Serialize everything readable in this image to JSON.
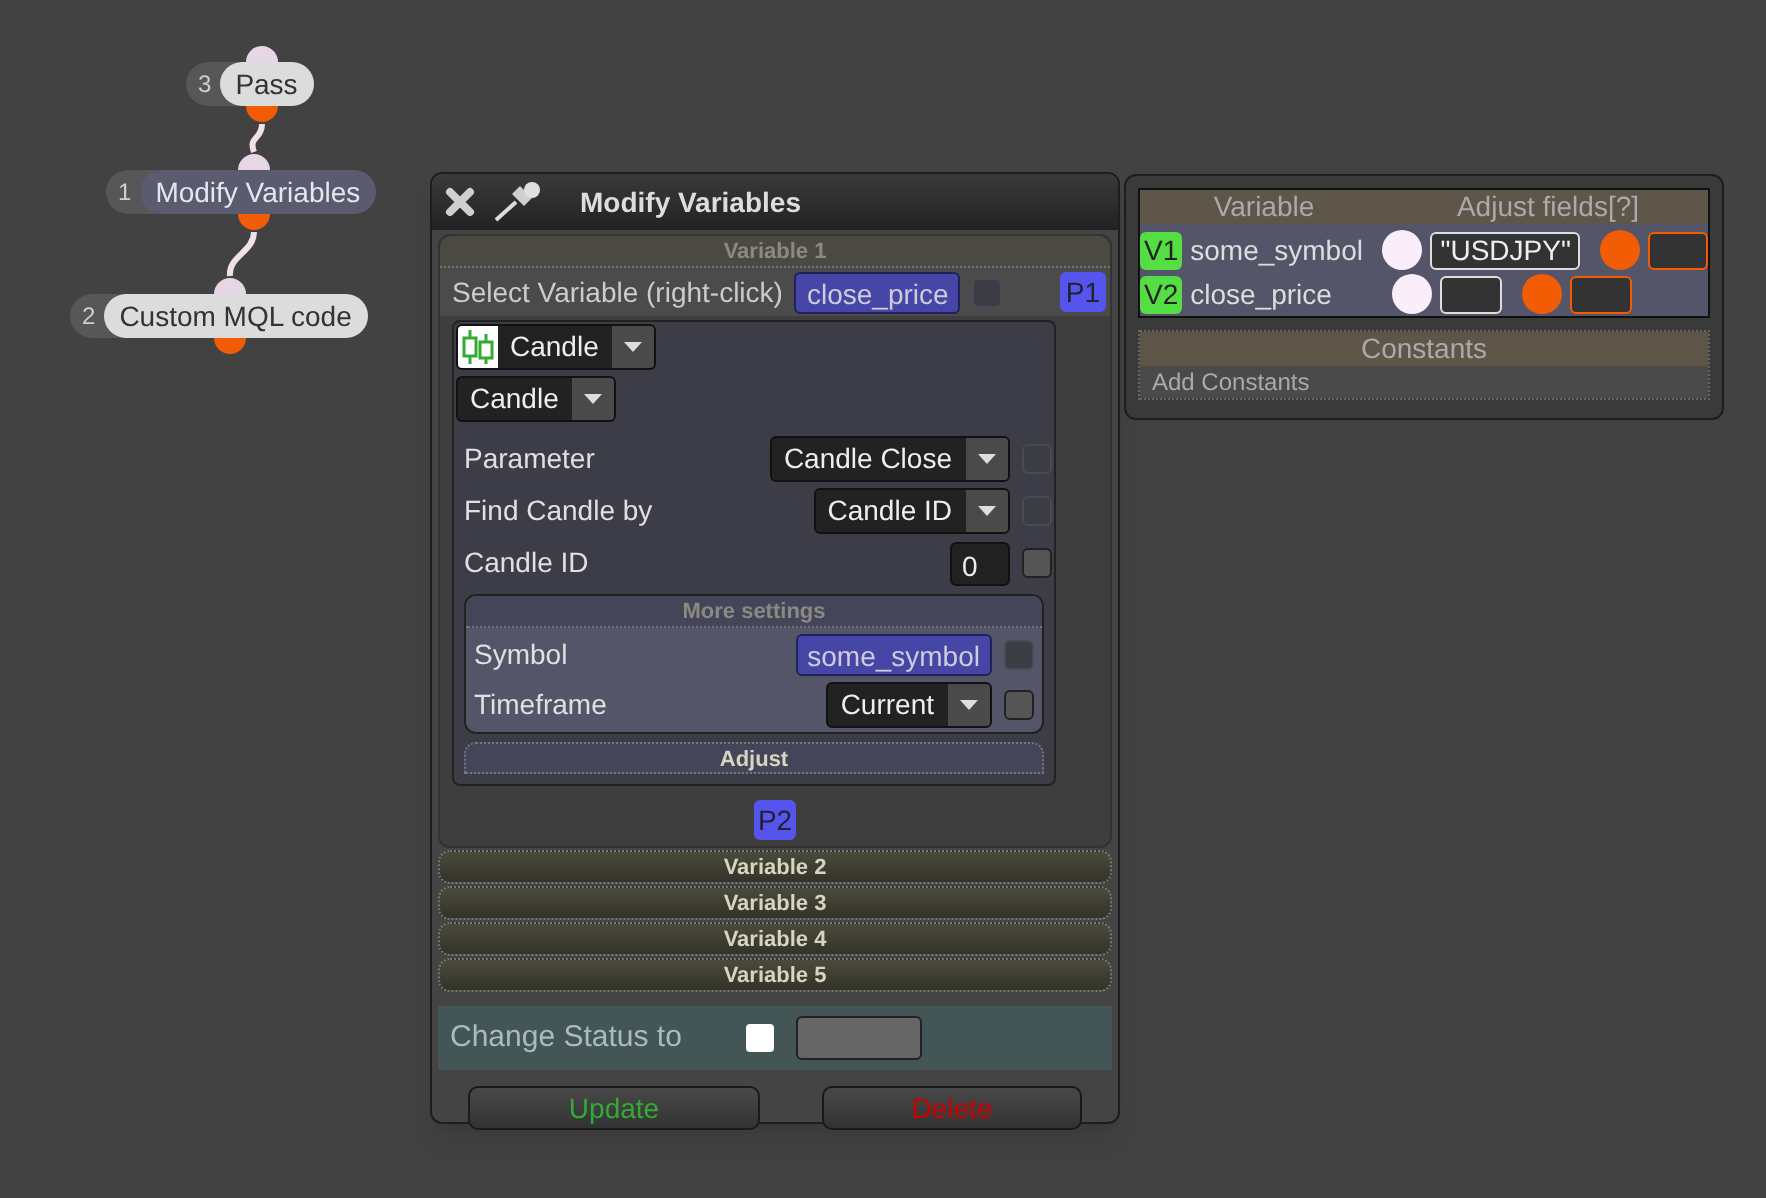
{
  "nodes": [
    {
      "number": "3",
      "label": "Pass",
      "selected": false
    },
    {
      "number": "1",
      "label": "Modify Variables",
      "selected": true
    },
    {
      "number": "2",
      "label": "Custom MQL code",
      "selected": false
    }
  ],
  "window": {
    "title": "Modify Variables",
    "variable_1": {
      "label": "Variable 1",
      "expanded": true
    },
    "select_variable": {
      "label": "Select Variable (right-click)",
      "value": "close_price",
      "checkbox": {
        "checked": false,
        "disabled": true
      },
      "badge": "P1"
    },
    "type_dropdown": "Candle",
    "sub_dropdown": "Candle",
    "rows": [
      {
        "kind": "dropdown",
        "label": "Parameter",
        "value": "Candle Close",
        "checkbox": {
          "checked": false,
          "disabled": true
        }
      },
      {
        "kind": "dropdown",
        "label": "Find Candle by",
        "value": "Candle ID",
        "checkbox": {
          "checked": false,
          "disabled": true
        }
      },
      {
        "kind": "number",
        "label": "Candle ID",
        "value": "0",
        "checkbox": {
          "checked": false,
          "disabled": false
        }
      }
    ],
    "more_settings": {
      "label": "More settings",
      "expanded": true,
      "rows": [
        {
          "kind": "variable",
          "label": "Symbol",
          "value": "some_symbol",
          "checkbox": {
            "checked": false,
            "disabled": true
          }
        },
        {
          "kind": "dropdown",
          "label": "Timeframe",
          "value": "Current",
          "checkbox": {
            "checked": false,
            "disabled": false
          }
        }
      ]
    },
    "adjust": {
      "label": "Adjust",
      "expanded": false
    },
    "badge_2": "P2",
    "other_variables": [
      {
        "label": "Variable 2",
        "expanded": false
      },
      {
        "label": "Variable 3",
        "expanded": false
      },
      {
        "label": "Variable 4",
        "expanded": false
      },
      {
        "label": "Variable 5",
        "expanded": false
      }
    ],
    "change_status": {
      "label": "Change Status to",
      "checked": false
    },
    "buttons": [
      {
        "label": "Update",
        "kind": "update"
      },
      {
        "label": "Delete",
        "kind": "delete"
      }
    ]
  },
  "variables_panel": {
    "columns": [
      "Variable",
      "Adjust fields[?]"
    ],
    "rows": [
      {
        "tag": "V1",
        "name": "some_symbol",
        "value": "\"USDJPY\""
      },
      {
        "tag": "V2",
        "name": "close_price"
      }
    ],
    "constants": {
      "title": "Constants",
      "action": "Add Constants"
    }
  }
}
